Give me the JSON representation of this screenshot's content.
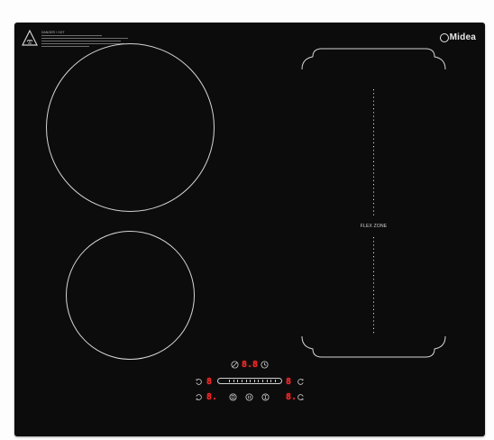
{
  "brand": {
    "name": "Midea"
  },
  "warning_label": {
    "title": "DANGER / HOT",
    "line_count": 5
  },
  "flex_zone": {
    "label": "FLEX ZONE"
  },
  "controls": {
    "timer_display": "8.8",
    "left_top_level": "8",
    "left_bottom_level": "8.",
    "right_top_level": "8",
    "right_bottom_level": "8."
  },
  "icons": {
    "power": "power-icon",
    "timer": "clock-icon",
    "zone_select": "zone-select-icon",
    "boost": "boost-icon",
    "lock": "lock-icon",
    "pause": "pause-icon",
    "keep_warm": "keep-warm-icon"
  },
  "colors": {
    "glass": "#0c0c0d",
    "outline": "#d6d6d6",
    "display": "#ff2a2a"
  }
}
